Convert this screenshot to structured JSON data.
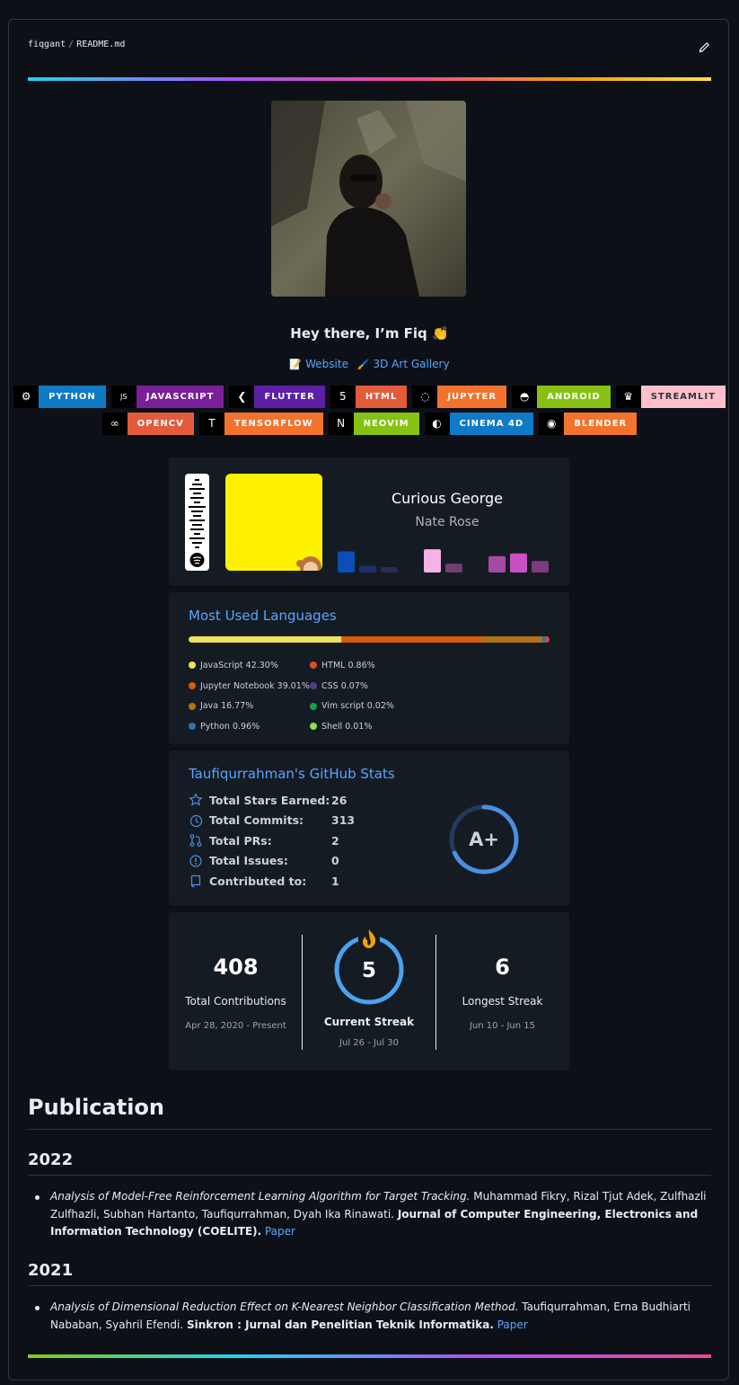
{
  "breadcrumb": {
    "owner": "fiqgant",
    "separator": "/",
    "file": "README.md"
  },
  "profile": {
    "greeting": "Hey there, I’m Fiq 👏",
    "links": [
      {
        "icon": "memo-icon",
        "label": "Website"
      },
      {
        "icon": "paintbrush-icon",
        "label": "3D Art Gallery"
      }
    ]
  },
  "badges_row1": [
    {
      "label": "PYTHON",
      "icon": "python-icon",
      "color": "#0f7ac6"
    },
    {
      "label": "JAVASCRIPT",
      "icon": "js-icon",
      "color": "#7a1f9a"
    },
    {
      "label": "FLUTTER",
      "icon": "flutter-icon",
      "color": "#5c1fa6"
    },
    {
      "label": "HTML",
      "icon": "html5-icon",
      "color": "#e25c3b"
    },
    {
      "label": "JUPYTER",
      "icon": "jupyter-icon",
      "color": "#f3732d"
    },
    {
      "label": "ANDROID",
      "icon": "android-icon",
      "color": "#86c113"
    },
    {
      "label": "STREAMLIT",
      "icon": "streamlit-icon",
      "color": "#ffc0cb",
      "text_color": "#333333"
    }
  ],
  "badges_row2": [
    {
      "label": "OPENCV",
      "icon": "opencv-icon",
      "color": "#e25c3b"
    },
    {
      "label": "TENSORFLOW",
      "icon": "tensorflow-icon",
      "color": "#f3732d"
    },
    {
      "label": "NEOVIM",
      "icon": "neovim-icon",
      "color": "#86c113"
    },
    {
      "label": "CINEMA 4D",
      "icon": "cinema4d-icon",
      "color": "#0f7ac6"
    },
    {
      "label": "BLENDER",
      "icon": "blender-icon",
      "color": "#f3732d"
    }
  ],
  "spotify": {
    "song": "Curious George",
    "artist": "Nate Rose",
    "bar_levels": [
      0.62,
      0.2,
      0.16,
      0.0,
      0.68,
      0.26,
      0.0,
      0.48,
      0.56,
      0.34
    ],
    "bar_colors": [
      "#0b4fb6",
      "#1d2f6a",
      "#232f57",
      "#151b23",
      "#f4b2e5",
      "#6f3f6e",
      "#151b23",
      "#a64aa6",
      "#c94fc2",
      "#7d3c80"
    ]
  },
  "languages": {
    "title": "Most Used Languages",
    "items": [
      {
        "name": "JavaScript",
        "percent": "42.30%",
        "value": 42.3,
        "color": "#f1e05a"
      },
      {
        "name": "Jupyter Notebook",
        "percent": "39.01%",
        "value": 39.01,
        "color": "#DA5B0B"
      },
      {
        "name": "Java",
        "percent": "16.77%",
        "value": 16.77,
        "color": "#b07219"
      },
      {
        "name": "Python",
        "percent": "0.96%",
        "value": 0.96,
        "color": "#3572A5"
      },
      {
        "name": "HTML",
        "percent": "0.86%",
        "value": 0.86,
        "color": "#e34c26"
      },
      {
        "name": "CSS",
        "percent": "0.07%",
        "value": 0.07,
        "color": "#563d7c"
      },
      {
        "name": "Vim script",
        "percent": "0.02%",
        "value": 0.02,
        "color": "#199f4b"
      },
      {
        "name": "Shell",
        "percent": "0.01%",
        "value": 0.01,
        "color": "#89e051"
      }
    ]
  },
  "github_stats": {
    "title": "Taufiqurrahman's GitHub Stats",
    "rows": [
      {
        "icon": "star-icon",
        "label": "Total Stars Earned:",
        "value": "26"
      },
      {
        "icon": "history-icon",
        "label": "Total Commits:",
        "value": "313"
      },
      {
        "icon": "pull-request-icon",
        "label": "Total PRs:",
        "value": "2"
      },
      {
        "icon": "issue-icon",
        "label": "Total Issues:",
        "value": "0"
      },
      {
        "icon": "repo-icon",
        "label": "Contributed to:",
        "value": "1"
      }
    ],
    "rank": "A+",
    "rank_progress": 0.68,
    "accent": "#4a90e2"
  },
  "streak": {
    "total": {
      "value": "408",
      "label": "Total Contributions",
      "range": "Apr 28, 2020 - Present"
    },
    "current": {
      "value": "5",
      "label": "Current Streak",
      "range": "Jul 26 - Jul 30"
    },
    "longest": {
      "value": "6",
      "label": "Longest Streak",
      "range": "Jun 10 - Jun 15"
    },
    "ring_color": "#4aa3f0",
    "fire_color": "#f59e0b"
  },
  "publication": {
    "heading": "Publication",
    "years": [
      {
        "year": "2022",
        "title": "Analysis of Model-Free Reinforcement Learning Algorithm for Target Tracking.",
        "authors": " Muhammad Fikry, Rizal Tjut Adek, Zulfhazli Zulfhazli, Subhan Hartanto, Taufiqurrahman, Dyah Ika Rinawati. ",
        "journal": "Journal of Computer Engineering, Electronics and Information Technology (COELITE).",
        "link": "Paper"
      },
      {
        "year": "2021",
        "title": "Analysis of Dimensional Reduction Effect on K-Nearest Neighbor Classification Method.",
        "authors": " Taufiqurrahman, Erna Budhiarti Nababan, Syahril Efendi. ",
        "journal": "Sinkron : Jurnal dan Penelitian Teknik Informatika.",
        "link": "Paper"
      }
    ]
  }
}
